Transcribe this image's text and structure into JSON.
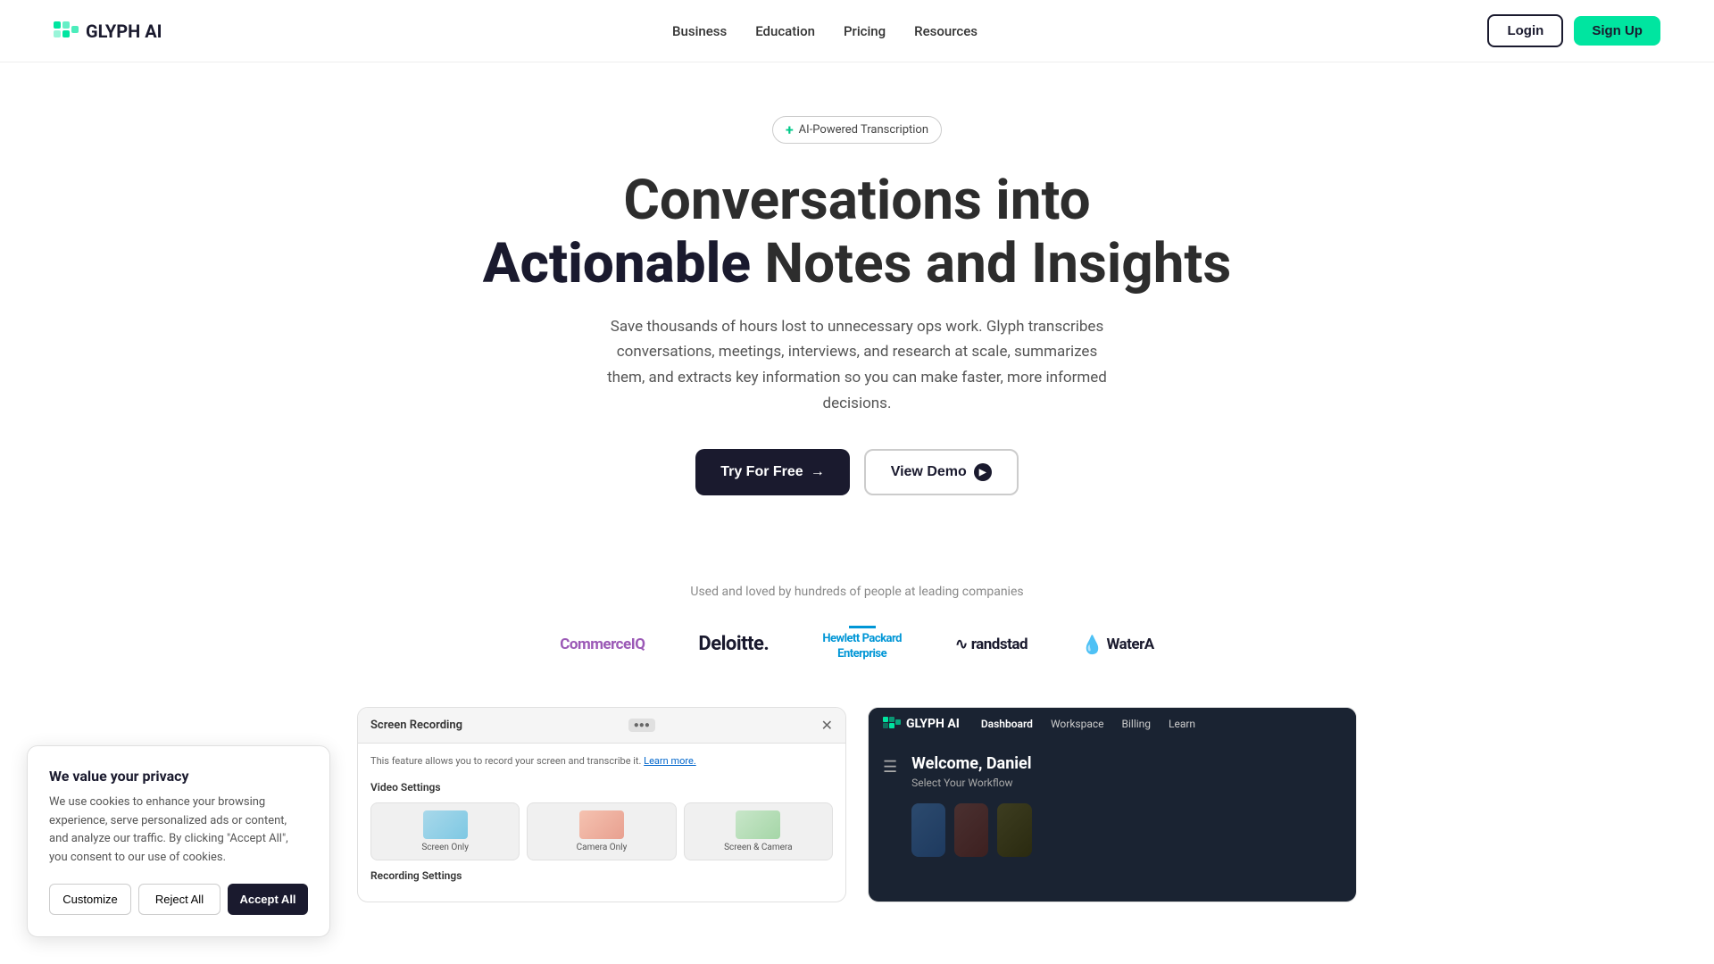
{
  "brand": {
    "name": "GLYPH AI",
    "tagline": "AI-Powered Transcription"
  },
  "nav": {
    "links": [
      {
        "label": "Business",
        "id": "business"
      },
      {
        "label": "Education",
        "id": "education"
      },
      {
        "label": "Pricing",
        "id": "pricing"
      },
      {
        "label": "Resources",
        "id": "resources"
      }
    ],
    "login_label": "Login",
    "signup_label": "Sign Up"
  },
  "hero": {
    "badge": "AI-Powered Transcription",
    "title_line1": "Conversations into",
    "title_line2_bold": "Actionable",
    "title_line2_rest": " Notes and Insights",
    "subtitle": "Save thousands of hours lost to unnecessary ops work. Glyph transcribes conversations, meetings, interviews, and research at scale, summarizes them, and extracts key information so you can make faster, more informed decisions.",
    "try_free_label": "Try For Free",
    "view_demo_label": "View Demo"
  },
  "companies": {
    "label": "Used and loved by hundreds of people at leading companies",
    "logos": [
      {
        "name": "CommerceIQ",
        "style": "commerce"
      },
      {
        "name": "Deloitte.",
        "style": "deloitte"
      },
      {
        "name": "Hewlett Packard Enterprise",
        "style": "hp"
      },
      {
        "name": "randstad",
        "style": "randstad"
      },
      {
        "name": "WaterA",
        "style": "water"
      }
    ]
  },
  "cookie": {
    "title": "We value your privacy",
    "text": "We use cookies to enhance your browsing experience, serve personalized ads or content, and analyze our traffic. By clicking \"Accept All\", you consent to our use of cookies.",
    "customize_label": "Customize",
    "reject_label": "Reject All",
    "accept_label": "Accept All"
  },
  "screenshot_left": {
    "title": "Screen Recording",
    "description": "This feature allows you to record your screen and transcribe it.",
    "learn_more": "Learn more.",
    "video_settings": "Video Settings",
    "options": [
      {
        "label": "Screen Only",
        "active": false
      },
      {
        "label": "Camera Only",
        "active": false
      },
      {
        "label": "Screen & Camera",
        "active": false
      }
    ],
    "recording_settings": "Recording Settings"
  },
  "screenshot_right": {
    "nav_links": [
      "Dashboard",
      "Workspace",
      "Billing",
      "Learn"
    ],
    "welcome": "Welcome, Daniel",
    "select_workflow": "Select Your Workflow"
  },
  "colors": {
    "accent_green": "#00e5a0",
    "brand_dark": "#1a1a2e",
    "commerce_purple": "#9b59b6",
    "hp_blue": "#0096d6"
  }
}
